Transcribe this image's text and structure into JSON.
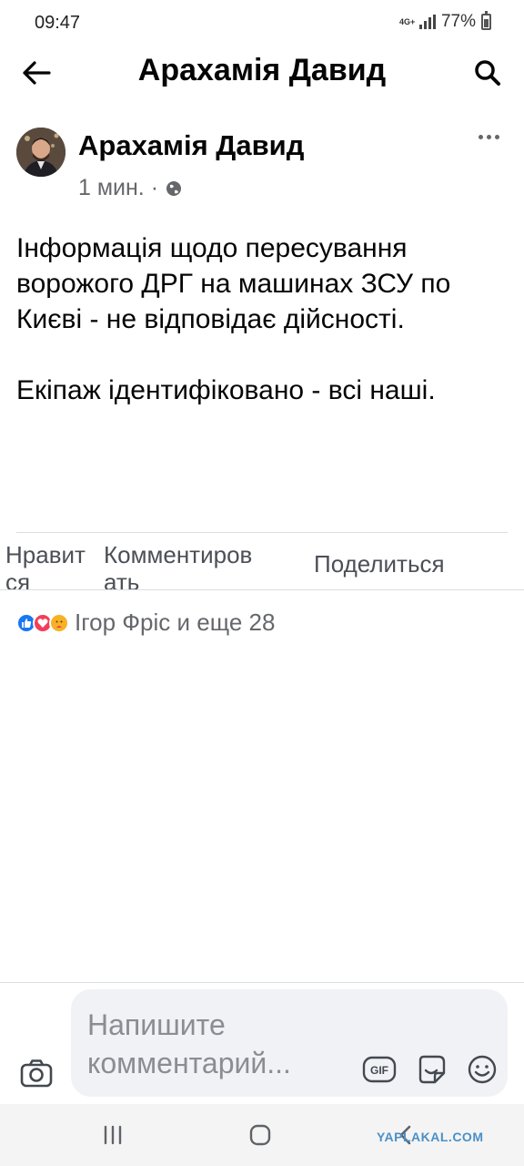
{
  "status_bar": {
    "time": "09:47",
    "network": "4G+",
    "battery_percent": "77%",
    "battery_level": 0.77
  },
  "header": {
    "title": "Арахамія Давид",
    "back_icon": "arrow-left-icon",
    "search_icon": "search-icon"
  },
  "post": {
    "author": "Арахамія Давид",
    "time": "1 мин. ·",
    "privacy_icon": "globe-icon",
    "paragraphs": [
      "Інформація щодо пересування ворожого ДРГ на машинах ЗСУ по Києві - не відповідає дійсності.",
      "Екіпаж ідентифіковано - всі наші."
    ]
  },
  "actions": {
    "like": "Нравится",
    "comment": "Комментировать",
    "share": "Поделиться"
  },
  "reactions": {
    "text": "Ігор Фріс и еще 28",
    "icons": [
      "like-reaction-icon",
      "love-reaction-icon",
      "care-reaction-icon"
    ],
    "colors": {
      "like": "#1877f2",
      "love": "#f33e58",
      "care": "#f7b125"
    }
  },
  "composer": {
    "placeholder": "Напишите комментарий..."
  },
  "watermark": "YAPLAKAL.COM"
}
